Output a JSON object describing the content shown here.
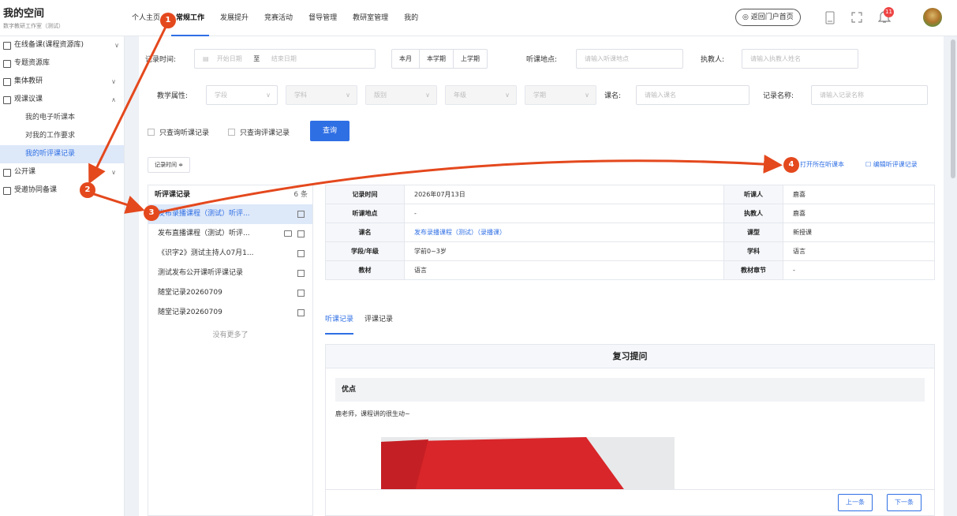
{
  "brand": {
    "title": "我的空间",
    "subtitle": "数字教研工作室（测试）"
  },
  "topnav": [
    "个人主页",
    "常规工作",
    "发展提升",
    "竞赛活动",
    "督导管理",
    "教研室管理",
    "我的"
  ],
  "topbar": {
    "portal": "返回门户首页",
    "bell_count": "11"
  },
  "sidebar": {
    "items": [
      {
        "label": "在线备课(课程资源库)",
        "chev": "∨"
      },
      {
        "label": "专题资源库",
        "chev": ""
      },
      {
        "label": "集体教研",
        "chev": "∨"
      },
      {
        "label": "观课议课",
        "chev": "∧"
      }
    ],
    "subitems": [
      "我的电子听课本",
      "对我的工作要求",
      "我的听评课记录"
    ],
    "items2": [
      {
        "label": "公开课",
        "chev": "∨"
      },
      {
        "label": "受邀协同备课",
        "chev": ""
      }
    ]
  },
  "filters": {
    "record_time_label": "记录时间:",
    "start_placeholder": "开始日期",
    "to": "至",
    "end_placeholder": "结束日期",
    "quick": [
      "本月",
      "本学期",
      "上学期"
    ],
    "place_label": "听课地点:",
    "place_placeholder": "请输入听课地点",
    "teacher_label": "执教人:",
    "teacher_placeholder": "请输入执教人姓名",
    "attr_label": "教学属性:",
    "selects": [
      "学段",
      "学科",
      "版别",
      "年级",
      "学期"
    ],
    "course_label": "课名:",
    "course_placeholder": "请输入课名",
    "record_name_label": "记录名称:",
    "record_name_placeholder": "请输入记录名称",
    "only_listen": "只查询听课记录",
    "only_review": "只查询评课记录",
    "query": "查询"
  },
  "sort": "记录时间 ≑",
  "actions": {
    "open_notebook": "打开所在听课本",
    "edit_record": "编辑听评课记录"
  },
  "list": {
    "title": "听评课记录",
    "count": "6 条",
    "rows": [
      "发布录播课程（测试）听评...",
      "发布直播课程（测试）听评...",
      "《识字2》测试主持人07月1...",
      "测试发布公开课听评课记录",
      "随堂记录20260709",
      "随堂记录20260709"
    ],
    "no_more": "没有更多了"
  },
  "info": {
    "r1": [
      "记录时间",
      "2026年07月13日",
      "听课人",
      "鹿喜"
    ],
    "r2": [
      "听课地点",
      "-",
      "执教人",
      "鹿喜"
    ],
    "r3": [
      "课名",
      "发布录播课程（测试）（录播课）",
      "课型",
      "新授课"
    ],
    "r4": [
      "学段/年级",
      "学前0~3岁",
      "学科",
      "语言"
    ],
    "r5": [
      "教材",
      "语言",
      "教材章节",
      "-"
    ]
  },
  "tabs": [
    "听课记录",
    "评课记录"
  ],
  "detail": {
    "heading": "复习提问",
    "section": "优点",
    "comment": "鹿老师，课程讲的很生动~"
  },
  "pager": {
    "prev": "上一条",
    "next": "下一条"
  },
  "annotations": [
    "1",
    "2",
    "3",
    "4"
  ]
}
